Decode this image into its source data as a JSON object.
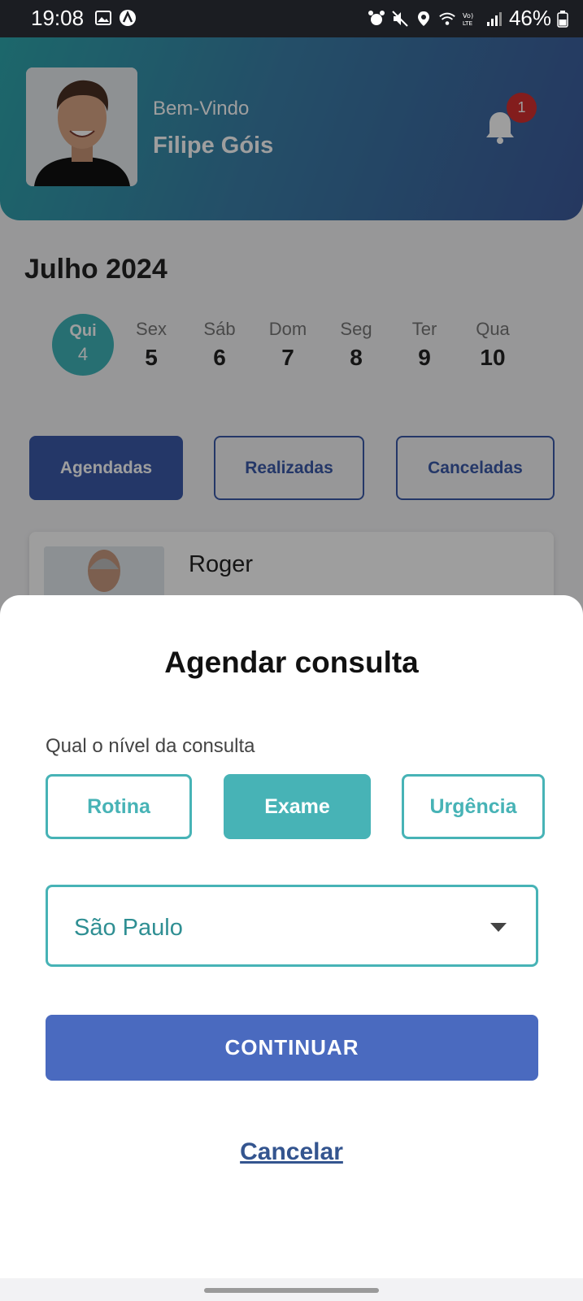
{
  "status_bar": {
    "time": "19:08",
    "battery": "46%",
    "left_icons": [
      "image-icon",
      "app-a-icon"
    ],
    "right_icons": [
      "alarm-icon",
      "mute-icon",
      "location-icon",
      "wifi-icon",
      "volte-icon",
      "signal-icon",
      "battery-icon"
    ]
  },
  "header": {
    "welcome": "Bem-Vindo",
    "user_name": "Filipe Góis",
    "notification_count": "1"
  },
  "calendar": {
    "month": "Julho 2024",
    "days": [
      {
        "name": "Qui",
        "num": "4"
      },
      {
        "name": "Sex",
        "num": "5"
      },
      {
        "name": "Sáb",
        "num": "6"
      },
      {
        "name": "Dom",
        "num": "7"
      },
      {
        "name": "Seg",
        "num": "8"
      },
      {
        "name": "Ter",
        "num": "9"
      },
      {
        "name": "Qua",
        "num": "10"
      }
    ]
  },
  "filters": {
    "scheduled": "Agendadas",
    "done": "Realizadas",
    "cancelled": "Canceladas"
  },
  "appointment_card": {
    "doctor_name": "Roger"
  },
  "sheet": {
    "title": "Agendar consulta",
    "level_label": "Qual o nível da consulta",
    "levels": [
      "Rotina",
      "Exame",
      "Urgência"
    ],
    "selected_level": "Exame",
    "city_value": "São Paulo",
    "continue_label": "CONTINUAR",
    "cancel_label": "Cancelar"
  },
  "colors": {
    "header_gradient_start": "#2ea7ad",
    "header_gradient_end": "#3d5a9c",
    "teal_accent": "#47b3b6",
    "primary_blue": "#4a6abf",
    "dark_blue": "#3a5aa8",
    "badge_red": "#d32f2f"
  }
}
